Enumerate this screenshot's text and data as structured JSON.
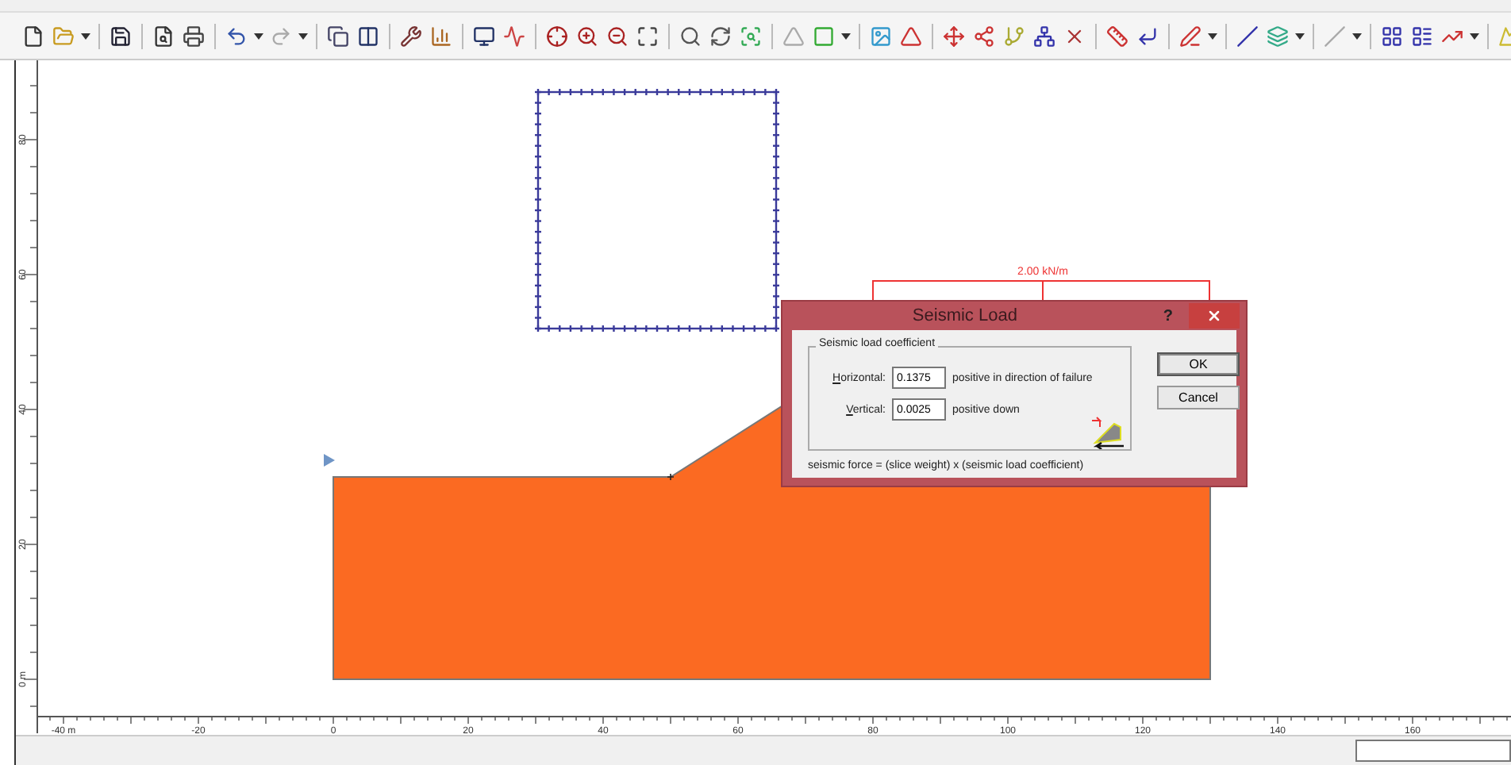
{
  "load": {
    "label": "2.00 kN/m"
  },
  "axes": {
    "y_labels": [
      "80",
      "60",
      "40",
      "20",
      "0 m"
    ],
    "x_labels": [
      "-40 m",
      "-20",
      "0",
      "20",
      "40",
      "60",
      "80",
      "100",
      "120",
      "140",
      "160"
    ]
  },
  "dialog": {
    "title": "Seismic Load",
    "help": "?",
    "group": "Seismic load coefficient",
    "fields": [
      {
        "label": "Horizontal:",
        "value": "0.1375",
        "hint": "positive in direction of failure"
      },
      {
        "label": "Vertical:",
        "value": "0.0025",
        "hint": "positive down"
      }
    ],
    "formula": "seismic force =  (slice weight) x (seismic load coefficient)",
    "buttons": [
      {
        "label": "OK",
        "default": true
      },
      {
        "label": "Cancel",
        "default": false
      }
    ]
  }
}
